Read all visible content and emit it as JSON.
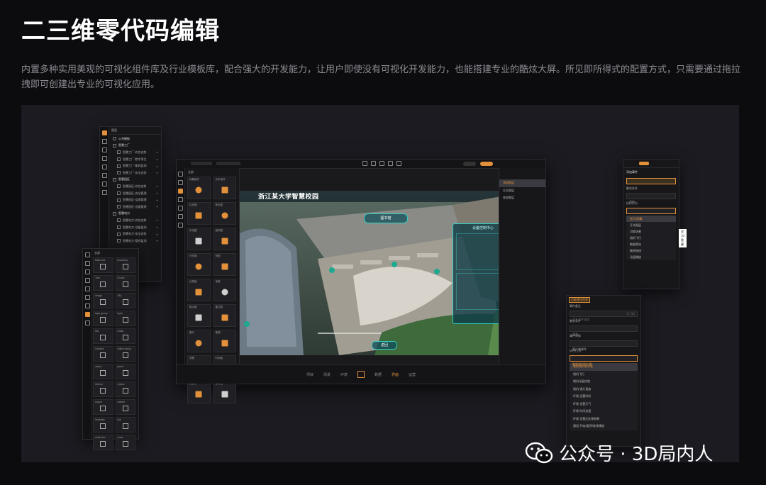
{
  "header": {
    "title": "二三维零代码编辑",
    "description": "内置多种实用美观的可视化组件库及行业模板库，配合强大的开发能力，让用户即使没有可视化开发能力，也能搭建专业的酷炫大屏。所见即所得式的配置方式，只需要通过拖拉拽即可创建出专业的可视化应用。"
  },
  "tree_panel": {
    "header": "图层",
    "items": [
      {
        "label": "公共模板",
        "group": true
      },
      {
        "label": "智慧工厂",
        "group": true
      },
      {
        "label": "智慧工厂-综合态势",
        "group": false
      },
      {
        "label": "智慧工厂-数字孪生",
        "group": false
      },
      {
        "label": "智慧工厂-能耗监测",
        "group": false
      },
      {
        "label": "智慧工厂-安全态势",
        "group": false
      },
      {
        "label": "智慧园区",
        "group": true
      },
      {
        "label": "智慧园区-综合态势",
        "group": false
      },
      {
        "label": "智慧园区-安全管理",
        "group": false
      },
      {
        "label": "智慧园区-运维管理",
        "group": false
      },
      {
        "label": "智慧园区-设备管理",
        "group": false
      },
      {
        "label": "智慧电力",
        "group": true
      },
      {
        "label": "智慧电力-综合态势",
        "group": false
      },
      {
        "label": "智慧电力-设备监测",
        "group": false
      },
      {
        "label": "智慧电力-安全态势",
        "group": false
      },
      {
        "label": "智慧电力-管线监测",
        "group": false
      }
    ]
  },
  "component_panel": {
    "header": "全部",
    "components": [
      "标题组件",
      "文本组件",
      "柱状图",
      "条形图",
      "折线图",
      "面积图",
      "环形图",
      "饼图",
      "仪表盘",
      "地图",
      "散点图",
      "雷达图",
      "图片",
      "视频",
      "表格",
      "时间轴",
      "颜色块",
      "漏斗图"
    ]
  },
  "model_panel": {
    "header": "全部",
    "items": [
      "base unit",
      "boundary",
      "Tree",
      "House",
      "Image",
      "Sky",
      "layer group",
      "layer",
      "link",
      "rotate",
      "Camera",
      "object group",
      "object",
      "panel",
      "refresh",
      "repeat",
      "region",
      "marker",
      "heatmap",
      "line",
      "shelf plus",
      "scale"
    ]
  },
  "editor": {
    "scene_title": "浙江某大学智慧校园",
    "building_label": "图书馆",
    "back_label": "返回",
    "control_title": "设备控制中心",
    "bottom_tabs": [
      "项目",
      "场景",
      "环境",
      "",
      "数据",
      "界面",
      "运营"
    ],
    "active_tab": 5,
    "layers": [
      "顶部图层",
      "交互图层",
      "底部图层"
    ]
  },
  "props_top": {
    "title": "添加事件",
    "trigger_label": "触发条件",
    "trigger_value": "点击",
    "action_label": "执行行为",
    "options": [
      "显示/隐藏",
      "开关图层",
      "切换场景",
      "相机飞行",
      "数据筛选",
      "跳转链接",
      "动画播放"
    ],
    "tooltip": "显示/隐藏"
  },
  "props_bottom": {
    "tab": "功能模块列表",
    "event_label": "事件备注",
    "event_placeholder": "用于事件描述",
    "count": "0 / 32",
    "trigger_label": "触发条件",
    "trigger_value": "点击",
    "target_label": "事件对象",
    "target_value": "客户端事件",
    "action_label": "执行行为",
    "action_value": "聚焦相机到对象",
    "options": [
      "聚焦相机到对象",
      "相机飞行",
      "相机动画控制",
      "相机·镜头速度",
      "环境·设置时间",
      "环境·设置天气",
      "环境·时间流速",
      "环境·设置后处理参数",
      "通用·开始/暂停/继续播放"
    ]
  },
  "watermark": {
    "text": "公众号 · 3D局内人"
  },
  "colors": {
    "accent": "#e2913a",
    "teal": "#33d0c0",
    "background": "#0c0c0f",
    "stage": "#1b1b21"
  }
}
